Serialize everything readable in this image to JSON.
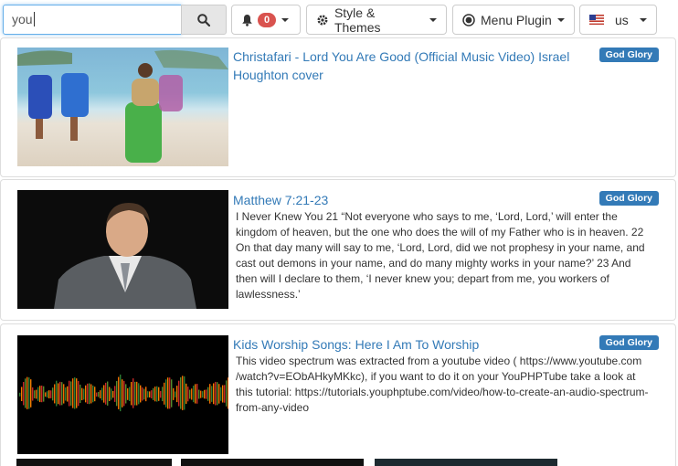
{
  "search": {
    "value": "you"
  },
  "toolbar": {
    "notifications_count": "0",
    "style_themes_label": "Style & Themes",
    "menu_plugin_label": "Menu Plugin",
    "language_label": "us"
  },
  "videos": [
    {
      "title": "Christafari - Lord You Are Good (Official Music Video) Israel Houghton cover",
      "description": "",
      "category": "God Glory"
    },
    {
      "title": "Matthew 7:21-23",
      "description": "I Never Knew You 21 “Not everyone who says to me, ‘Lord, Lord,’ will enter the kingdom of heaven, but the one who does the will of my Father who is in heaven. 22 On that day many will say to me, ‘Lord, Lord, did we not prophesy in your name, and cast out demons in your name, and do many mighty works in your name?’ 23 And then will I declare to them, ‘I never knew you; depart from me, you workers of lawlessness.’",
      "category": "God Glory"
    },
    {
      "title": "Kids Worship Songs: Here I Am To Worship",
      "description": "This video spectrum was extracted from a youtube video ( https://www.youtube.com /watch?v=EObAHkyMKkc), if you want to do it on your YouPHPTube take a look at this tutorial: https://tutorials.youphptube.com/video/how-to-create-an-audio-spectrum-from-any-video",
      "category": "God Glory"
    }
  ],
  "colors": {
    "link": "#337ab7",
    "badge": "#d9534f",
    "label": "#337ab7"
  }
}
